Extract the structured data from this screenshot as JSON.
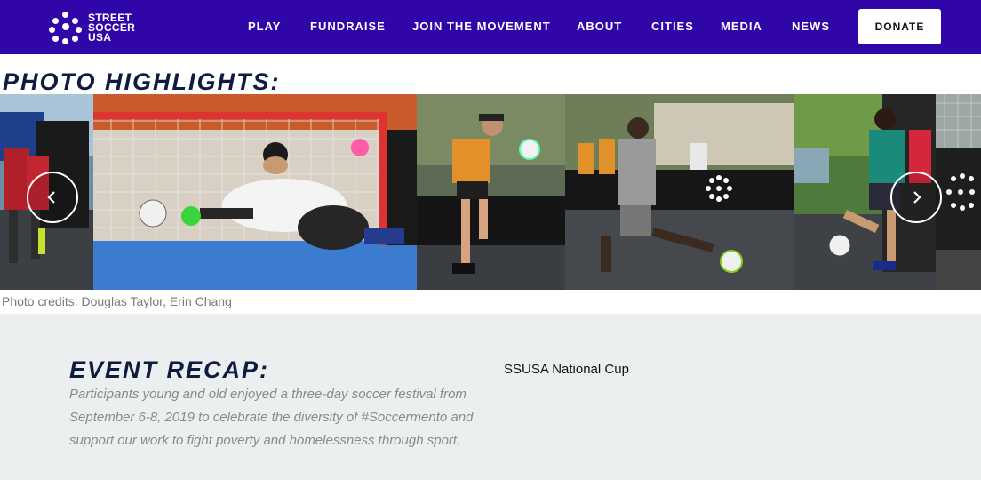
{
  "nav": {
    "logo_text_1": "STREET",
    "logo_text_2": "SOCCER",
    "logo_text_3": "USA",
    "links": [
      "PLAY",
      "FUNDRAISE",
      "JOIN THE MOVEMENT",
      "ABOUT",
      "CITIES",
      "MEDIA",
      "NEWS"
    ],
    "donate": "DONATE",
    "bg_color": "#3106a8"
  },
  "highlights": {
    "title": "PHOTO HIGHLIGHTS:",
    "credits": "Photo credits: Douglas Taylor, Erin Chang",
    "prev_icon": "chevron-left-icon",
    "next_icon": "chevron-right-icon"
  },
  "recap": {
    "title": "EVENT RECAP:",
    "body": "Participants young and old enjoyed a three-day soccer festival from September 6-8, 2019 to celebrate the diversity of #Soccermento and support our work to fight poverty and homelessness through sport.",
    "side_label": "SSUSA National Cup"
  }
}
